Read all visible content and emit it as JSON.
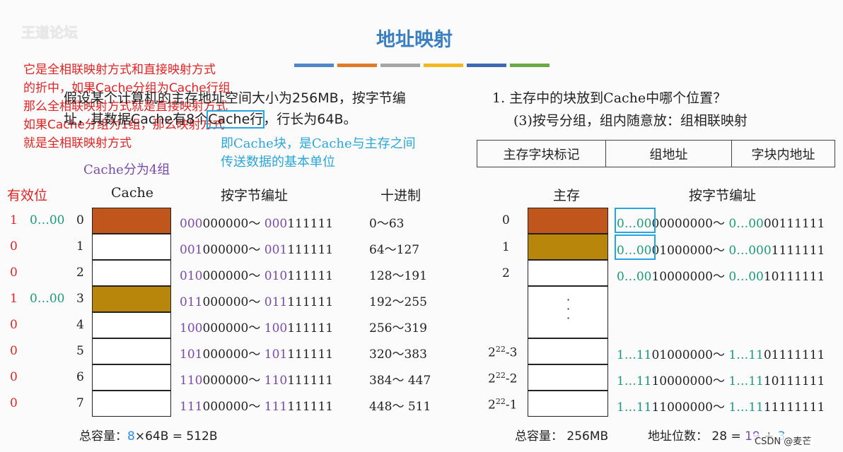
{
  "header": {
    "logo": "王道论坛",
    "title": "地址映射"
  },
  "colors": {
    "bars": [
      "#4f86c6",
      "#e07b29",
      "#a6a6a6",
      "#f2b81d",
      "#3f68b5",
      "#6aab46"
    ],
    "red": "#e02424",
    "blue": "#2aa6d8",
    "purple": "#7a4aa8",
    "orange": "#c0561c",
    "gold": "#b8860b"
  },
  "red_note": [
    "它是全相联映射方式和直接映射方式",
    "的折中，如果Cache分组为Cache行组",
    "那么全相联映射方式就是直接映射方式",
    "如果Cache分组为1组，那么映射方式",
    "就是全相联映射方式"
  ],
  "question": {
    "line1": "假设某个计算机的主存地址空间大小为256MB，按字节编",
    "line2_a": "址，其数据Cache有8个",
    "line2_b": "Cache行",
    "line2_c": "，行长为64B。"
  },
  "blue_note": {
    "line1": "即Cache块，是Cache与主存之间",
    "line2": "传送数据的基本单位"
  },
  "group_note": "Cache分为4组",
  "right_q": {
    "line1": "1. 主存中的块放到Cache中哪个位置？",
    "line2": "(3)按号分组，组内随意放：组相联映射"
  },
  "addr_format": [
    "主存字块标记",
    "组地址",
    "字块内地址"
  ],
  "headers": {
    "valid": "有效位",
    "cache": "Cache",
    "byte_addr": "按字节编址",
    "decimal": "十进制",
    "main": "主存",
    "byte_addr2": "按字节编址"
  },
  "cache_rows": [
    {
      "valid": "1",
      "tag": "0…00",
      "idx": "0",
      "p": "000",
      "t": "000000",
      "p2": "000",
      "t2": "111111",
      "dec": "0～63"
    },
    {
      "valid": "0",
      "tag": "",
      "idx": "1",
      "p": "001",
      "t": "000000",
      "p2": "001",
      "t2": "111111",
      "dec": "64～127"
    },
    {
      "valid": "0",
      "tag": "",
      "idx": "2",
      "p": "010",
      "t": "000000",
      "p2": "010",
      "t2": "111111",
      "dec": "128～191"
    },
    {
      "valid": "1",
      "tag": "0…00",
      "idx": "3",
      "p": "011",
      "t": "000000",
      "p2": "011",
      "t2": "111111",
      "dec": "192～255"
    },
    {
      "valid": "0",
      "tag": "",
      "idx": "4",
      "p": "100",
      "t": "000000",
      "p2": "100",
      "t2": "111111",
      "dec": "256～319"
    },
    {
      "valid": "0",
      "tag": "",
      "idx": "5",
      "p": "101",
      "t": "000000",
      "p2": "101",
      "t2": "111111",
      "dec": "320～383"
    },
    {
      "valid": "0",
      "tag": "",
      "idx": "6",
      "p": "110",
      "t": "000000",
      "p2": "110",
      "t2": "111111",
      "dec": "384～ 447"
    },
    {
      "valid": "0",
      "tag": "",
      "idx": "7",
      "p": "111",
      "t": "000000",
      "p2": "111",
      "t2": "111111",
      "dec": "448～ 511"
    }
  ],
  "mem_rows": [
    {
      "label": "0",
      "a1": "0…0",
      "a2": "0",
      "a3": "0000000000",
      "sep": "～ ",
      "b1": "0…000",
      "b2": "0111111"
    },
    {
      "label": "1",
      "a1": "0…0",
      "a2": "0",
      "a3": "1000000",
      "sep": "～ ",
      "b1": "0…000",
      "b2": "1111111"
    },
    {
      "label": "2",
      "a1": "0…00",
      "a2": "10",
      "a3": "000000",
      "sep": "～ ",
      "b1": "0…00",
      "b2": "10111111"
    },
    {
      "label": "2²²-3",
      "a1": "1…110",
      "a2": "1",
      "a3": "000000",
      "sep": "～ ",
      "b1": "1…110",
      "b2": "1111111"
    },
    {
      "label": "2²²-2",
      "a1": "1…11",
      "a2": "10",
      "a3": "000000",
      "sep": "～ ",
      "b1": "1…11",
      "b2": "10111111"
    },
    {
      "label": "2²²-1",
      "a1": "1…111",
      "a2": "1",
      "a3": "000000",
      "sep": "～ ",
      "b1": "1…111",
      "b2": "1111111"
    }
  ],
  "mem_labels": {
    "l3": "2",
    "e3": "22",
    "s3": "-3",
    "l4": "2",
    "e4": "22",
    "s4": "-2",
    "l5": "2",
    "e5": "22",
    "s5": "-1"
  },
  "mem_addr_text": [
    {
      "a": "0…00",
      "b": "00000000～ ",
      "c": "0…00",
      "d": "00111111"
    },
    {
      "a": "0…00",
      "b": "01000000～ ",
      "c": "0…000",
      "d": "1111111"
    },
    {
      "a": "0…00",
      "b": "10000000～ ",
      "c": "0…00",
      "d": "10111111"
    },
    {
      "a": "1…11",
      "b": "01000000～ ",
      "c": "1…11",
      "d": "01111111"
    },
    {
      "a": "1…11",
      "b": "10000000～ ",
      "c": "1…11",
      "d": "10111111"
    },
    {
      "a": "1…11",
      "b": "11000000～ ",
      "c": "1…11",
      "d": "11111111"
    }
  ],
  "footer": {
    "left_a": "总容量：",
    "left_b": "8",
    "left_c": "×64B = 512B",
    "right_a": "总容量：  256MB",
    "right_b": "地址位数：  28 =",
    "right_c": "19",
    "right_d": " + ",
    "right_e": "3",
    "watermark": "CSDN @麦芒"
  },
  "dots": "·\n·\n·"
}
